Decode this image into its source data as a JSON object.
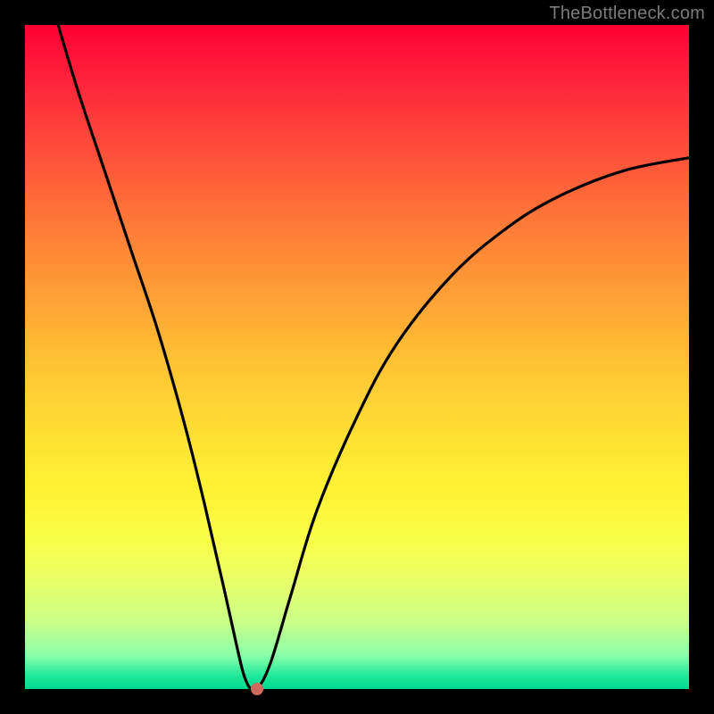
{
  "watermark": "TheBottleneck.com",
  "colors": {
    "frame": "#000000",
    "curve": "#000000",
    "marker": "#d0695f",
    "gradient_top": "#ff0033",
    "gradient_bottom": "#00d890"
  },
  "chart_data": {
    "type": "line",
    "title": "",
    "xlabel": "",
    "ylabel": "",
    "xlim": [
      0,
      100
    ],
    "ylim": [
      0,
      100
    ],
    "grid": false,
    "legend": false,
    "series": [
      {
        "name": "curve",
        "x": [
          5,
          8,
          12,
          16,
          20,
          24,
          27,
          30,
          32,
          33,
          34,
          35,
          37,
          40,
          44,
          50,
          56,
          64,
          72,
          80,
          90,
          100
        ],
        "values": [
          100,
          90,
          78,
          66,
          54,
          40,
          28,
          15,
          6,
          2,
          0,
          0,
          4,
          14,
          27,
          41,
          52,
          62,
          69,
          74,
          78,
          80
        ]
      }
    ],
    "annotations": [
      {
        "type": "point",
        "x": 35,
        "y": 0,
        "label": "min-marker"
      }
    ]
  }
}
